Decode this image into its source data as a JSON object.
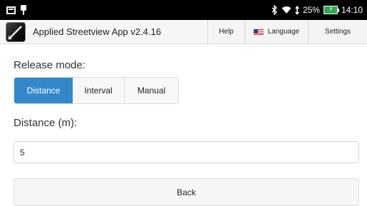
{
  "status_bar": {
    "battery_percent": "25%",
    "time": "14:10",
    "icons": [
      "notification-icon",
      "location-pin-icon",
      "bluetooth-icon",
      "wifi-icon",
      "data-transfer-icon",
      "battery-charging-icon"
    ]
  },
  "header": {
    "title": "Applied Streetview App v2.4.16",
    "help_label": "Help",
    "language_label": "Language",
    "settings_label": "Settings"
  },
  "release_mode": {
    "label": "Release mode:",
    "options": [
      "Distance",
      "Interval",
      "Manual"
    ],
    "selected": "Distance"
  },
  "distance": {
    "label": "Distance (m):",
    "value": "5"
  },
  "back_label": "Back",
  "colors": {
    "accent": "#3388cc",
    "status_bar": "#000000",
    "header_bg": "#f6f6f6"
  }
}
